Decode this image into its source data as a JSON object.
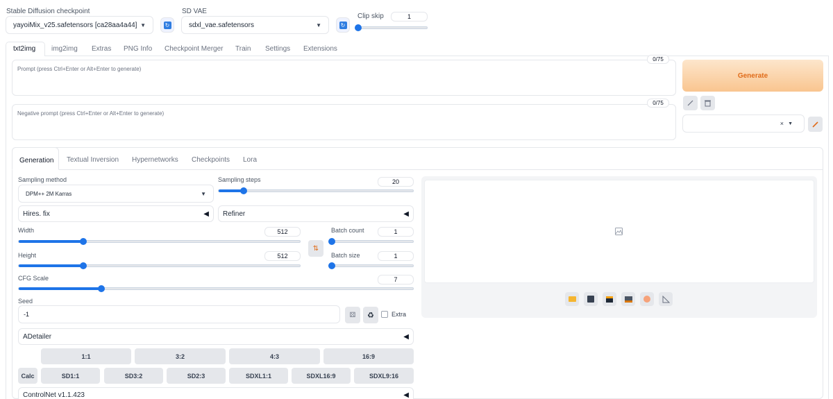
{
  "top": {
    "checkpoint_label": "Stable Diffusion checkpoint",
    "checkpoint_value": "yayoiMix_v25.safetensors [ca28aa4a44]",
    "vae_label": "SD VAE",
    "vae_value": "sdxl_vae.safetensors",
    "clipskip_label": "Clip skip",
    "clipskip_value": "1"
  },
  "main_tabs": [
    "txt2img",
    "img2img",
    "Extras",
    "PNG Info",
    "Checkpoint Merger",
    "Train",
    "Settings",
    "Extensions"
  ],
  "prompt": {
    "placeholder": "Prompt (press Ctrl+Enter or Alt+Enter to generate)",
    "counter": "0/75"
  },
  "negative": {
    "placeholder": "Negative prompt (press Ctrl+Enter or Alt+Enter to generate)",
    "counter": "0/75"
  },
  "generate_label": "Generate",
  "styles_clear": "×",
  "sub_tabs": [
    "Generation",
    "Textual Inversion",
    "Hypernetworks",
    "Checkpoints",
    "Lora"
  ],
  "gen": {
    "sampling_method_label": "Sampling method",
    "sampling_method_value": "DPM++ 2M Karras",
    "sampling_steps_label": "Sampling steps",
    "sampling_steps_value": "20",
    "hires_label": "Hires. fix",
    "refiner_label": "Refiner",
    "width_label": "Width",
    "width_value": "512",
    "height_label": "Height",
    "height_value": "512",
    "batch_count_label": "Batch count",
    "batch_count_value": "1",
    "batch_size_label": "Batch size",
    "batch_size_value": "1",
    "cfg_label": "CFG Scale",
    "cfg_value": "7",
    "seed_label": "Seed",
    "seed_value": "-1",
    "extra_label": "Extra",
    "adetailer_label": "ADetailer",
    "ratios": [
      "1:1",
      "3:2",
      "4:3",
      "16:9"
    ],
    "calc_label": "Calc",
    "presets": [
      "SD1:1",
      "SD3:2",
      "SD2:3",
      "SDXL1:1",
      "SDXL16:9",
      "SDXL9:16"
    ],
    "controlnet_label": "ControlNet v1.1.423"
  },
  "sliders": {
    "clipskip_fraction": 0.0,
    "steps_fraction": 0.13,
    "width_fraction": 0.23,
    "height_fraction": 0.23,
    "batch_count_fraction": 0.0,
    "batch_size_fraction": 0.0,
    "cfg_fraction": 0.21
  },
  "colors": {
    "accent": "#1e74e8",
    "generate_text": "#e06c1a"
  }
}
